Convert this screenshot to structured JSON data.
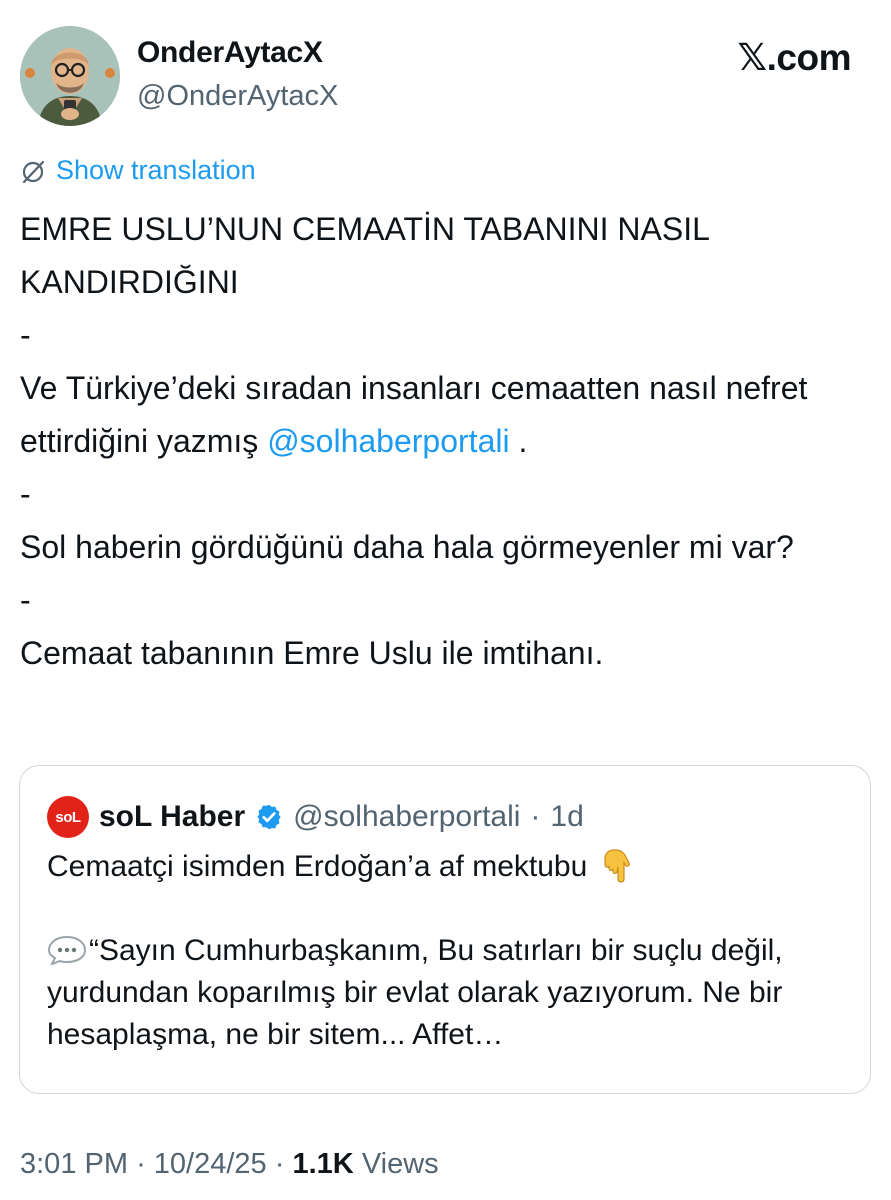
{
  "author": {
    "display_name": "OnderAytacX",
    "handle": "@OnderAytacX"
  },
  "brand": {
    "x": "𝕏",
    "suffix": ".com"
  },
  "translation": {
    "label": "Show translation",
    "icon": "globe-slash-icon"
  },
  "tweet": {
    "line1": "EMRE USLU’NUN CEMAATİN TABANINI NASIL KANDIRDIĞINI",
    "dash1": "-",
    "line2_prefix": "Ve Türkiye’deki sıradan insanları cemaatten nasıl nefret ettirdiğini yazmış ",
    "line2_mention": "@solhaberportali",
    "line2_suffix": " .",
    "dash2": "-",
    "line3": "Sol haberin gördüğünü daha hala görmeyenler mi var?",
    "dash3": "-",
    "line4": "Cemaat tabanının Emre Uslu ile imtihanı."
  },
  "quote": {
    "logo_text": "soL",
    "name": "soL Haber",
    "handle": "@solhaberportali",
    "separator": "·",
    "age": "1d",
    "verified_icon": "verified-badge-icon",
    "title": "Cemaatçi isimden Erdoğan’a af mektubu",
    "title_emoji": "pointing-down-icon",
    "body_icon": "speech-bubble-icon",
    "body": "“Sayın Cumhurbaşkanım, Bu satırları bir suçlu değil, yurdundan koparılmış bir evlat olarak yazıyorum. Ne bir hesaplaşma, ne bir sitem... Affet…"
  },
  "footer": {
    "time": "3:01 PM",
    "sep1": "·",
    "date": "10/24/25",
    "sep2": "·",
    "views_count": "1.1K",
    "views_label": "Views"
  },
  "colors": {
    "link": "#1d9bf0",
    "muted": "#536471",
    "text": "#0f1419",
    "border": "#cfd9de",
    "brand_red": "#e2231a"
  }
}
